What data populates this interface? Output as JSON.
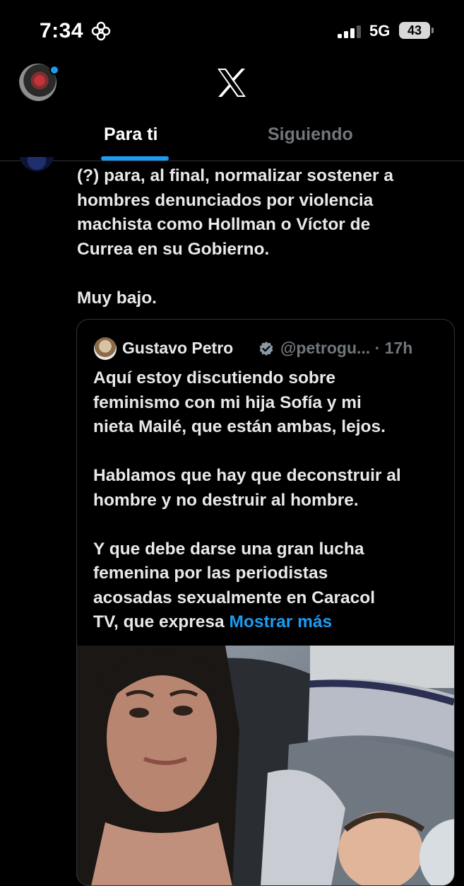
{
  "status_bar": {
    "time": "7:34",
    "network": "5G",
    "battery": "43"
  },
  "header": {
    "logo": "x-logo-icon",
    "tabs": [
      {
        "label": "Para ti",
        "active": true
      },
      {
        "label": "Siguiendo",
        "active": false
      }
    ]
  },
  "tweet": {
    "text": "(?) para, al final, normalizar sostener a\nhombres denunciados por violencia\nmachista como Hollman o Víctor de\nCurrea en su Gobierno.\n\nMuy bajo."
  },
  "quoted_tweet": {
    "name": "Gustavo Petro",
    "handle": "@petrogu... · 17h",
    "text": "Aquí estoy discutiendo sobre\nfeminismo con mi hija Sofía y mi\nnieta Mailé, que están ambas, lejos.\n\nHablamos que hay que deconstruir al\nhombre y no destruir al hombre.\n\nY que debe darse una gran lucha\nfemenina por las periodistas\nacosadas sexualmente en Caracol\nTV, que expresa ",
    "show_more": "Mostrar más"
  },
  "colors": {
    "accent": "#1d9bf0",
    "background": "#000000",
    "text": "#e7e9ea",
    "muted": "#71767b"
  }
}
